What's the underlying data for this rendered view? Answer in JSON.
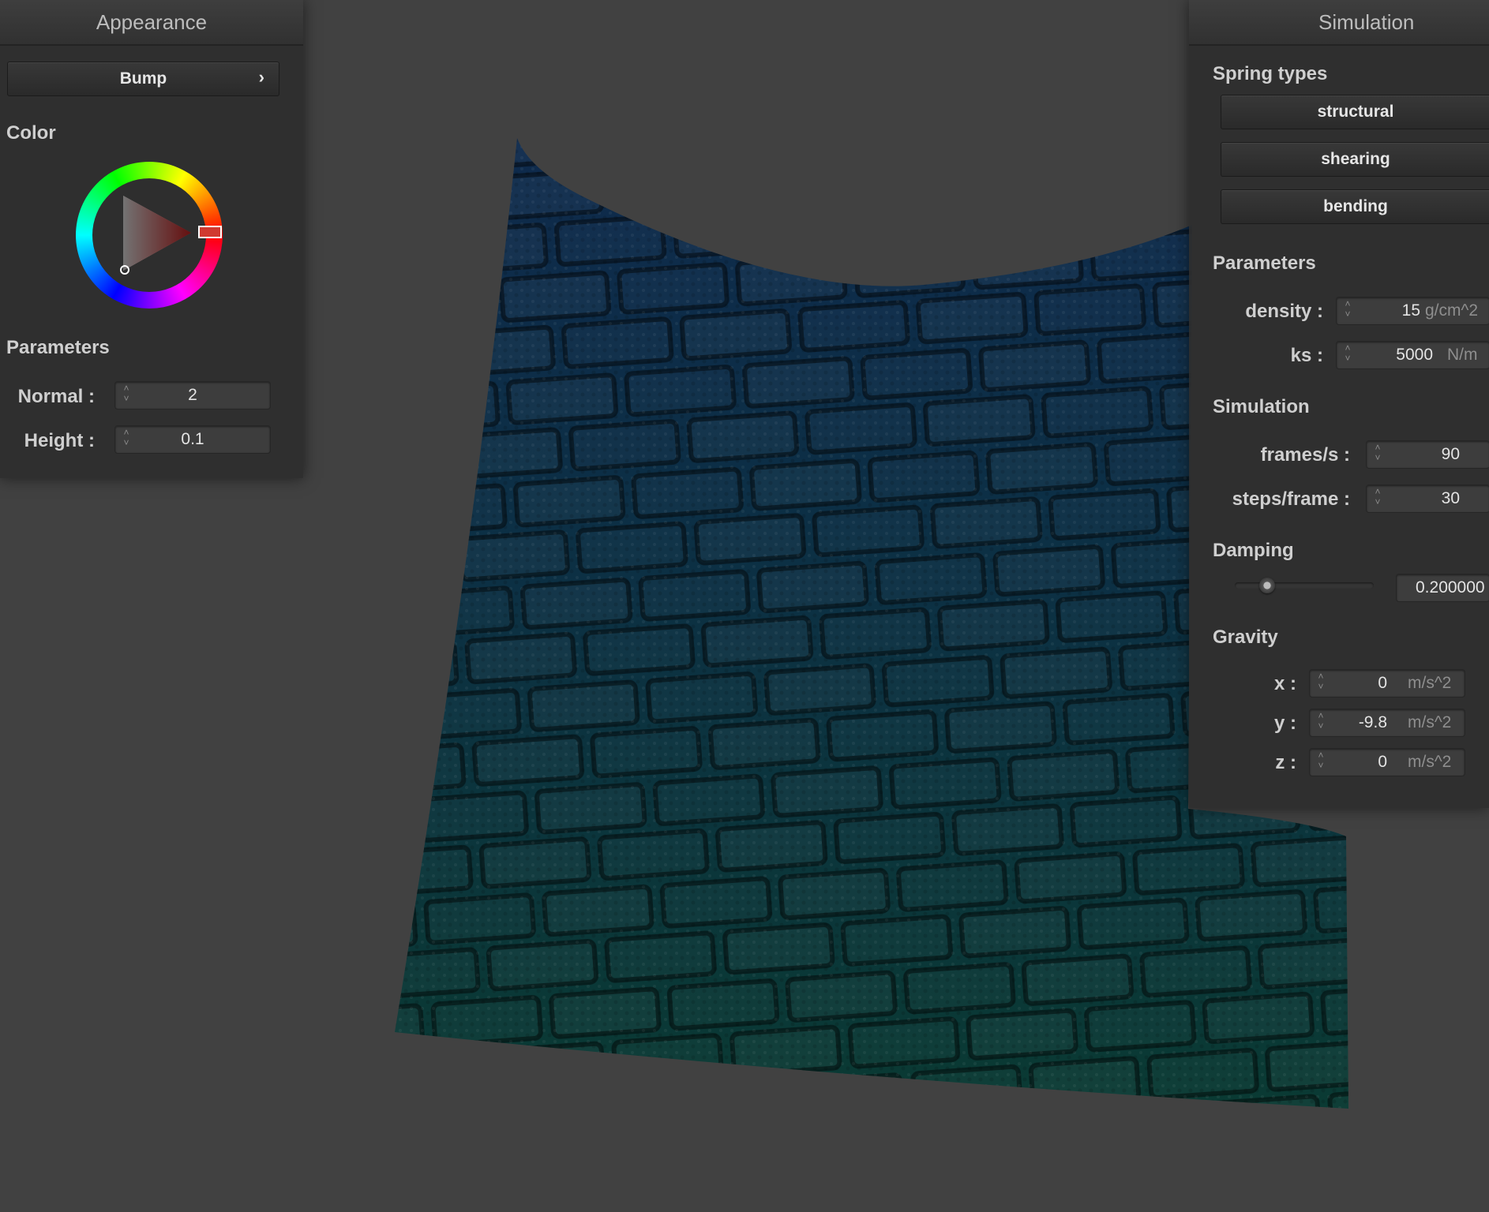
{
  "appearance": {
    "title": "Appearance",
    "shader_button": "Bump",
    "shader_chevron": "›",
    "color_label": "Color",
    "color_wheel_icon": "color-wheel-icon",
    "selected_color": "#d03a30",
    "parameters_label": "Parameters",
    "normal_label": "Normal :",
    "normal_value": "2",
    "height_label": "Height :",
    "height_value": "0.1"
  },
  "simulation": {
    "title": "Simulation",
    "spring_types_label": "Spring types",
    "spring_buttons": [
      "structural",
      "shearing",
      "bending"
    ],
    "parameters_label": "Parameters",
    "density_label": "density :",
    "density_value": "15",
    "density_unit": "g/cm^2",
    "ks_label": "ks :",
    "ks_value": "5000",
    "ks_unit": "N/m",
    "sim_label": "Simulation",
    "fps_label": "frames/s :",
    "fps_value": "90",
    "steps_label": "steps/frame :",
    "steps_value": "30",
    "damping_label": "Damping",
    "damping_value": "0.200000",
    "damping_fraction": 0.2,
    "gravity_label": "Gravity",
    "gx_label": "x :",
    "gx_value": "0",
    "gy_label": "y :",
    "gy_value": "-9.8",
    "gz_label": "z :",
    "gz_value": "0",
    "gravity_unit": "m/s^2"
  },
  "colors": {
    "background": "#414141",
    "cloth_top": "#0e2a4a",
    "cloth_bottom": "#0c3a34"
  },
  "spinner_icon": "spinner-arrows-icon"
}
